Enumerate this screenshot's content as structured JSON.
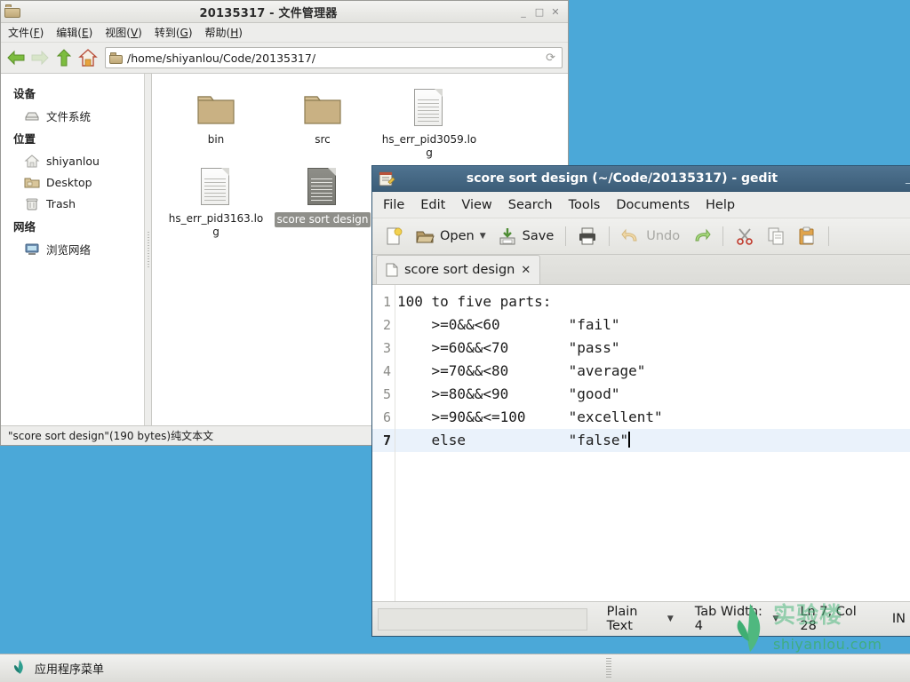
{
  "desktop": {
    "background": "#4ba8d8"
  },
  "filemanager": {
    "title": "20135317 - 文件管理器",
    "title_icon": "folder-icon",
    "window_buttons": {
      "minimize": "_",
      "maximize": "□",
      "close": "✕"
    },
    "menus": [
      {
        "label": "文件(F)",
        "text": "文件(",
        "accel": "F",
        "tail": ")"
      },
      {
        "label": "编辑(E)",
        "text": "编辑(",
        "accel": "E",
        "tail": ")"
      },
      {
        "label": "视图(V)",
        "text": "视图(",
        "accel": "V",
        "tail": ")"
      },
      {
        "label": "转到(G)",
        "text": "转到(",
        "accel": "G",
        "tail": ")"
      },
      {
        "label": "帮助(H)",
        "text": "帮助(",
        "accel": "H",
        "tail": ")"
      }
    ],
    "toolbar": {
      "back": "back-arrow-icon",
      "forward": "forward-arrow-icon",
      "up": "up-arrow-icon",
      "home": "home-icon",
      "reload": "reload-icon"
    },
    "path": "/home/shiyanlou/Code/20135317/",
    "sidebar": {
      "sections": [
        {
          "header": "设备",
          "items": [
            {
              "label": "文件系统",
              "icon": "drive-icon"
            }
          ]
        },
        {
          "header": "位置",
          "items": [
            {
              "label": "shiyanlou",
              "icon": "home-icon"
            },
            {
              "label": "Desktop",
              "icon": "desktop-folder-icon"
            },
            {
              "label": "Trash",
              "icon": "trash-icon"
            }
          ]
        },
        {
          "header": "网络",
          "items": [
            {
              "label": "浏览网络",
              "icon": "network-icon"
            }
          ]
        }
      ]
    },
    "files": [
      {
        "name": "bin",
        "type": "folder",
        "selected": false
      },
      {
        "name": "src",
        "type": "folder",
        "selected": false
      },
      {
        "name": "hs_err_pid3059.log",
        "type": "document",
        "selected": false
      },
      {
        "name": "hs_err_pid3163.log",
        "type": "document",
        "selected": false
      },
      {
        "name": "score sort design",
        "type": "document-dark",
        "selected": true
      },
      {
        "name": "",
        "type": "none",
        "selected": false
      }
    ],
    "statusbar": "\"score sort design\"(190 bytes)纯文本文"
  },
  "gedit": {
    "title": "score sort design (~/Code/20135317) - gedit",
    "title_icon": "gedit-notepad-icon",
    "window_buttons": {
      "minimize": "_"
    },
    "menus": [
      {
        "label": "File"
      },
      {
        "label": "Edit"
      },
      {
        "label": "View"
      },
      {
        "label": "Search"
      },
      {
        "label": "Tools"
      },
      {
        "label": "Documents"
      },
      {
        "label": "Help"
      }
    ],
    "toolbar": [
      {
        "name": "new-document-button",
        "icon": "new-document-icon",
        "label": "",
        "disabled": false
      },
      {
        "name": "open-button",
        "icon": "open-folder-icon",
        "label": "Open",
        "disabled": false,
        "has_caret": true
      },
      {
        "name": "save-button",
        "icon": "save-icon",
        "label": "Save",
        "disabled": false
      },
      {
        "name": "print-button",
        "icon": "printer-icon",
        "label": "",
        "disabled": false
      },
      {
        "name": "undo-button",
        "icon": "undo-arrow-icon",
        "label": "Undo",
        "disabled": true
      },
      {
        "name": "redo-button",
        "icon": "redo-arrow-icon",
        "label": "",
        "disabled": false
      },
      {
        "name": "cut-button",
        "icon": "scissors-icon",
        "label": "",
        "disabled": false
      },
      {
        "name": "copy-button",
        "icon": "copy-icon",
        "label": "",
        "disabled": true
      },
      {
        "name": "paste-button",
        "icon": "clipboard-paste-icon",
        "label": "",
        "disabled": false
      }
    ],
    "tab": {
      "label": "score sort design",
      "icon": "document-icon",
      "close": "✕"
    },
    "editor": {
      "lines": [
        {
          "no": "1",
          "text": "100 to five parts:",
          "current": false
        },
        {
          "no": "2",
          "text": "    >=0&&<60        \"fail\"",
          "current": false
        },
        {
          "no": "3",
          "text": "    >=60&&<70       \"pass\"",
          "current": false
        },
        {
          "no": "4",
          "text": "    >=70&&<80       \"average\"",
          "current": false
        },
        {
          "no": "5",
          "text": "    >=80&&<90       \"good\"",
          "current": false
        },
        {
          "no": "6",
          "text": "    >=90&&<=100     \"excellent\"",
          "current": false
        },
        {
          "no": "7",
          "text": "    else            \"false\"",
          "current": true
        }
      ]
    },
    "statusbar": {
      "language": "Plain Text",
      "tab_width": "Tab Width: 4",
      "position": "Ln 7, Col 28",
      "insert_mode": "IN"
    }
  },
  "watermark": {
    "logo": "leaf-logo-icon",
    "text": "实验楼",
    "sub": "shiyanlou.com"
  },
  "taskbar": {
    "app_menu_label": "应用程序菜单",
    "app_menu_icon": "shiyanlou-leaf-icon"
  }
}
